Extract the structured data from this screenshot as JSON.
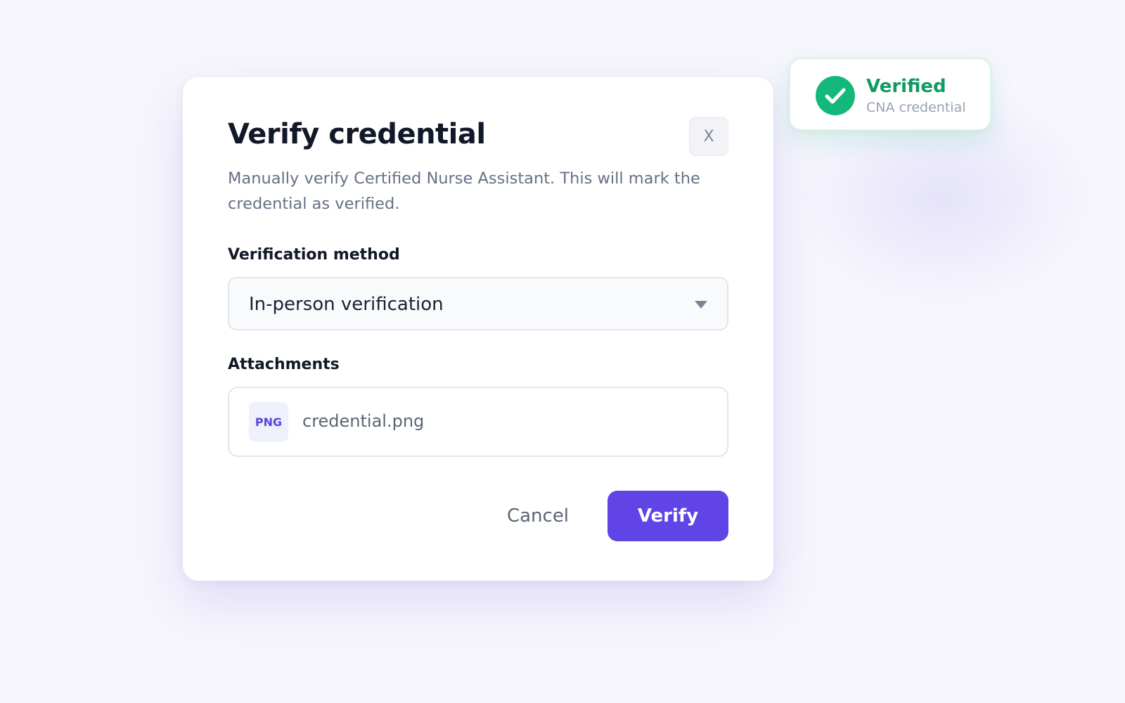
{
  "dialog": {
    "title": "Verify credential",
    "close_label": "X",
    "description": "Manually verify Certified Nurse Assistant. This will mark the credential as verified.",
    "method": {
      "label": "Verification method",
      "selected": "In-person verification"
    },
    "attachments": {
      "label": "Attachments",
      "files": [
        {
          "type": "PNG",
          "name": "credential.png"
        }
      ]
    },
    "actions": {
      "cancel": "Cancel",
      "verify": "Verify"
    }
  },
  "toast": {
    "title": "Verified",
    "subtitle": "CNA credential",
    "icon": "check-circle-icon"
  },
  "colors": {
    "primary": "#6144e6",
    "success": "#14b87a",
    "success_text": "#0f9b63",
    "background": "#f6f6fc"
  }
}
